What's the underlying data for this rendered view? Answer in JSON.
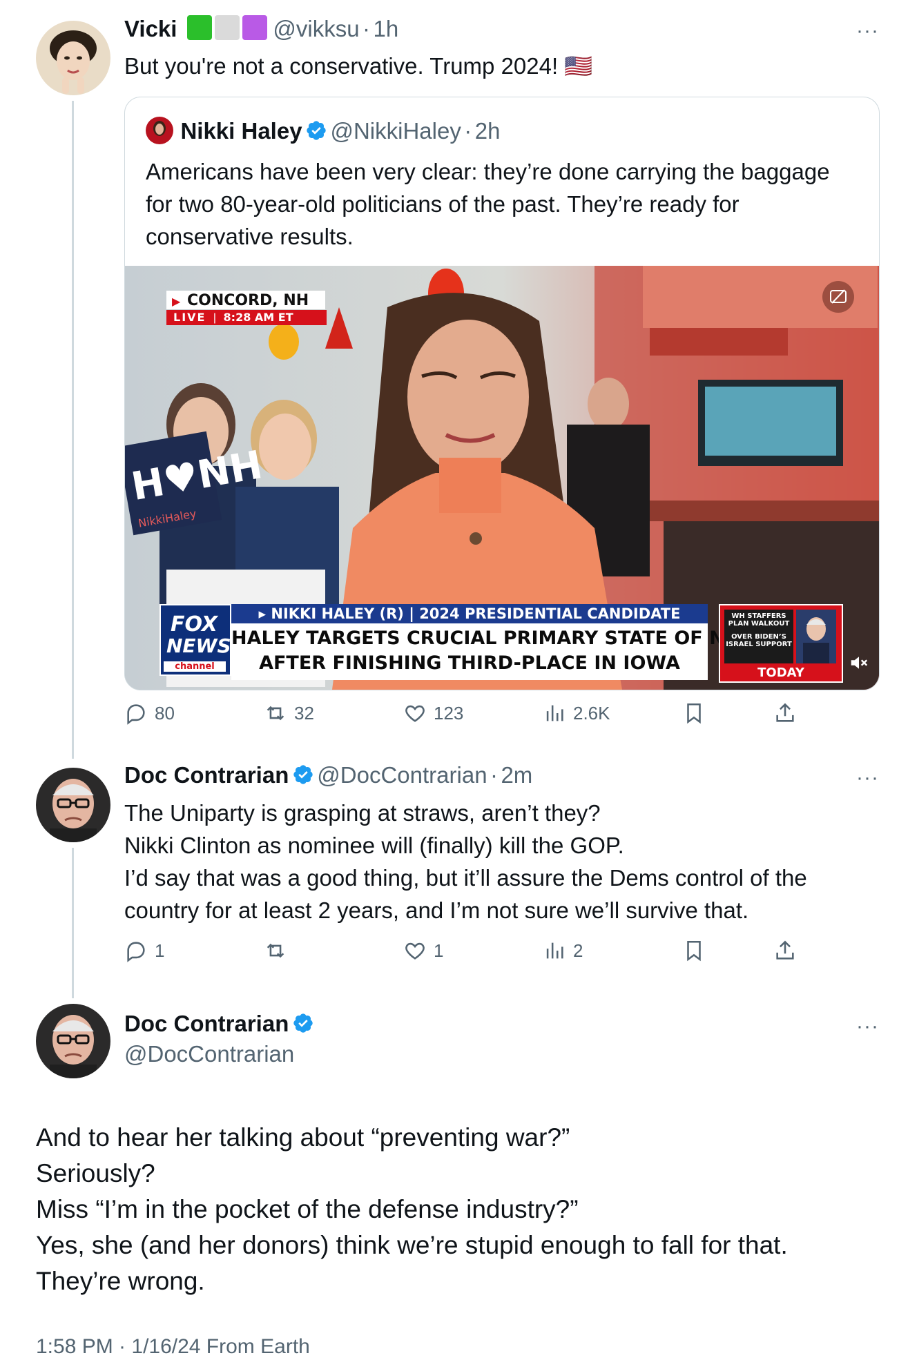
{
  "reply1": {
    "name": "Vicki",
    "handle": "@vikksu",
    "dot": "·",
    "time": "1h",
    "text": "But you're not a conservative. Trump 2024! 🇺🇸",
    "more": "···"
  },
  "quote": {
    "name": "Nikki Haley",
    "handle": "@NikkiHaley",
    "dot": "·",
    "time": "2h",
    "text_lines": [
      "Americans have been very clear: they’re done carrying the baggage",
      "for two 80-year-old politicians of the past. They’re ready for",
      "conservative results."
    ]
  },
  "video": {
    "location": "CONCORD, NH",
    "live": "LIVE",
    "live_time": "8:28 AM ET",
    "banner_top": "▸ NIKKI HALEY (R) | 2024 PRESIDENTIAL CANDIDATE",
    "headline_1": "HALEY TARGETS CRUCIAL PRIMARY STATE OF NH",
    "headline_2": "AFTER FINISHING THIRD-PLACE IN IOWA",
    "logo_1": "FOX",
    "logo_2": "NEWS",
    "logo_3": "channel",
    "side_1": "WH STAFFERS",
    "side_2": "PLAN WALKOUT",
    "side_3": "OVER BIDEN’S",
    "side_4": "ISRAEL SUPPORT",
    "side_today": "TODAY",
    "sign": "H♥NH",
    "sign_small": "NikkiHaley"
  },
  "reply1_metrics": {
    "replies": "80",
    "reposts": "32",
    "likes": "123",
    "views": "2.6K"
  },
  "reply2": {
    "name": "Doc Contrarian",
    "handle": "@DocContrarian",
    "dot": "·",
    "time": "2m",
    "text_lines": [
      "The Uniparty is grasping at straws, aren’t they?",
      "Nikki Clinton as nominee will (finally) kill the GOP.",
      "I’d say that was a good thing, but it’ll assure the Dems control of the",
      "country for at least 2 years, and I’m not sure we’ll survive that."
    ],
    "more": "···"
  },
  "reply2_metrics": {
    "replies": "1",
    "reposts": "",
    "likes": "1",
    "views": "2"
  },
  "main": {
    "name": "Doc Contrarian",
    "handle": "@DocContrarian",
    "more": "···",
    "text_lines": [
      "And to hear her talking about “preventing war?”",
      "Seriously?",
      "Miss “I’m in the pocket of the defense industry?”",
      "Yes, she (and her donors) think we’re stupid enough to fall for that.",
      "They’re wrong."
    ],
    "timestamp": "1:58 PM · 1/16/24 From Earth"
  },
  "colors": {
    "text": "#0f1419",
    "secondary": "#536471",
    "verified": "#1d9bf0",
    "border": "#cfd9de",
    "fox_red": "#d6111b",
    "fox_blue": "#1b3b8f",
    "sweater": "#f08a62"
  }
}
